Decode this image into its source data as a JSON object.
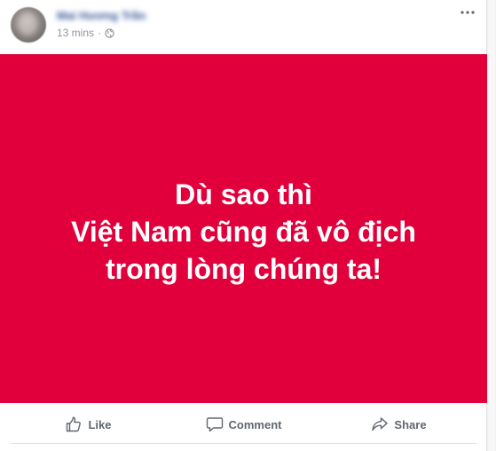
{
  "post": {
    "author_name": "Mai Hương Trần",
    "timestamp": "13 mins",
    "separator": "·",
    "privacy_icon": "globe-icon",
    "menu_icon": "more-options-icon"
  },
  "banner": {
    "background_color": "#e1003b",
    "text_color": "#ffffff",
    "lines": [
      "Dù sao thì",
      "Việt Nam cũng đã vô địch",
      "trong lòng chúng ta!"
    ]
  },
  "actions": {
    "like_label": "Like",
    "comment_label": "Comment",
    "share_label": "Share",
    "like_icon": "thumbs-up-icon",
    "comment_icon": "comment-bubble-icon",
    "share_icon": "share-arrow-icon"
  }
}
